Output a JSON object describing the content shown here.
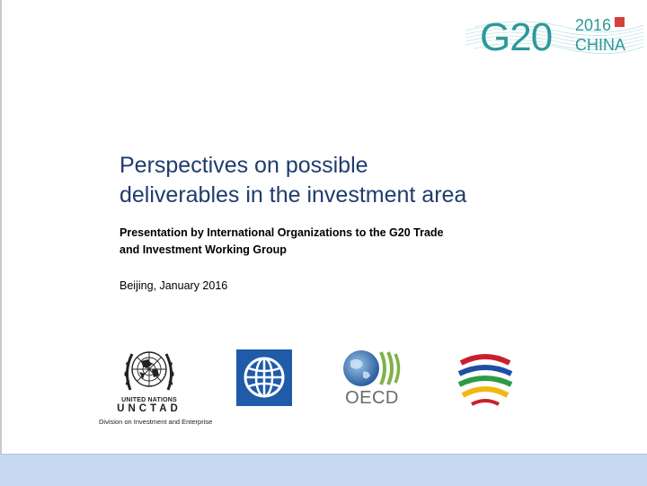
{
  "header": {
    "logo_g20_text": "G20",
    "logo_year": "2016",
    "logo_country": "CHINA"
  },
  "slide": {
    "title_lines": [
      "Perspectives on possible",
      "deliverables in the investment area"
    ],
    "subtitle_lines": [
      "Presentation by International Organizations to the G20 Trade",
      "and Investment Working Group"
    ],
    "date": "Beijing, January 2016"
  },
  "logos": {
    "un": {
      "name": "UNITED NATIONS",
      "acronym": "UNCTAD",
      "division": "Division on Investment and Enterprise"
    },
    "oecd": {
      "wordmark": "OECD"
    }
  },
  "colors": {
    "title": "#1f3c6e",
    "band": "#c6d9f1",
    "world_bank": "#1f5ba8",
    "g20_teal": "#3aa6a6"
  }
}
